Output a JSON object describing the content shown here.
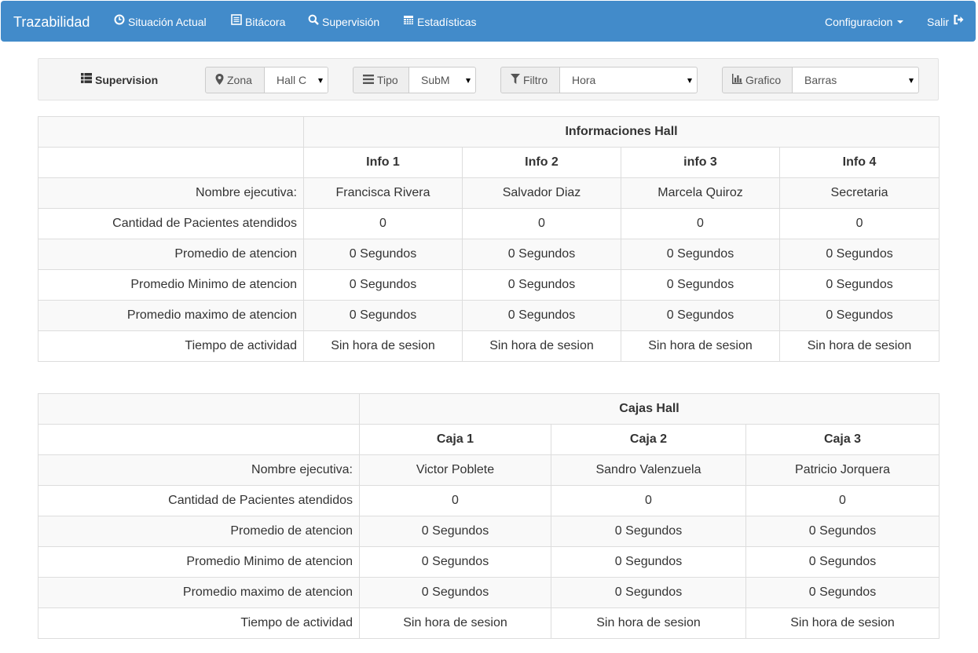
{
  "navbar": {
    "brand": "Trazabilidad",
    "links": [
      {
        "label": "Situación Actual",
        "icon": "clock-icon"
      },
      {
        "label": "Bitácora",
        "icon": "list-icon"
      },
      {
        "label": "Supervisión",
        "icon": "search-icon"
      },
      {
        "label": "Estadísticas",
        "icon": "calendar-icon"
      }
    ],
    "config_label": "Configuracion",
    "logout_label": "Salir",
    "color": "#428bca"
  },
  "toolbar": {
    "title": "Supervision",
    "filters": [
      {
        "label": "Zona",
        "icon": "map-marker-icon",
        "value": "Hall C"
      },
      {
        "label": "Tipo",
        "icon": "list-icon",
        "value": "SubM"
      },
      {
        "label": "Filtro",
        "icon": "filter-icon",
        "value": "Hora"
      },
      {
        "label": "Grafico",
        "icon": "bar-chart-icon",
        "value": "Barras"
      }
    ]
  },
  "info_table": {
    "title": "Informaciones Hall",
    "columns": [
      "Info 1",
      "Info 2",
      "info 3",
      "Info 4"
    ],
    "rows": [
      {
        "label": "Nombre ejecutiva:",
        "values": [
          "Francisca Rivera",
          "Salvador Diaz",
          "Marcela Quiroz",
          "Secretaria"
        ]
      },
      {
        "label": "Cantidad de Pacientes atendidos",
        "values": [
          "0",
          "0",
          "0",
          "0"
        ]
      },
      {
        "label": "Promedio de atencion",
        "values": [
          "0 Segundos",
          "0 Segundos",
          "0 Segundos",
          "0 Segundos"
        ]
      },
      {
        "label": "Promedio Minimo de atencion",
        "values": [
          "0 Segundos",
          "0 Segundos",
          "0 Segundos",
          "0 Segundos"
        ]
      },
      {
        "label": "Promedio maximo de atencion",
        "values": [
          "0 Segundos",
          "0 Segundos",
          "0 Segundos",
          "0 Segundos"
        ]
      },
      {
        "label": "Tiempo de actividad",
        "values": [
          "Sin hora de sesion",
          "Sin hora de sesion",
          "Sin hora de sesion",
          "Sin hora de sesion"
        ]
      }
    ]
  },
  "cajas_table": {
    "title": "Cajas Hall",
    "columns": [
      "Caja 1",
      "Caja 2",
      "Caja 3"
    ],
    "rows": [
      {
        "label": "Nombre ejecutiva:",
        "values": [
          "Victor Poblete",
          "Sandro Valenzuela",
          "Patricio Jorquera"
        ]
      },
      {
        "label": "Cantidad de Pacientes atendidos",
        "values": [
          "0",
          "0",
          "0"
        ]
      },
      {
        "label": "Promedio de atencion",
        "values": [
          "0 Segundos",
          "0 Segundos",
          "0 Segundos"
        ]
      },
      {
        "label": "Promedio Minimo de atencion",
        "values": [
          "0 Segundos",
          "0 Segundos",
          "0 Segundos"
        ]
      },
      {
        "label": "Promedio maximo de atencion",
        "values": [
          "0 Segundos",
          "0 Segundos",
          "0 Segundos"
        ]
      },
      {
        "label": "Tiempo de actividad",
        "values": [
          "Sin hora de sesion",
          "Sin hora de sesion",
          "Sin hora de sesion"
        ]
      }
    ]
  }
}
